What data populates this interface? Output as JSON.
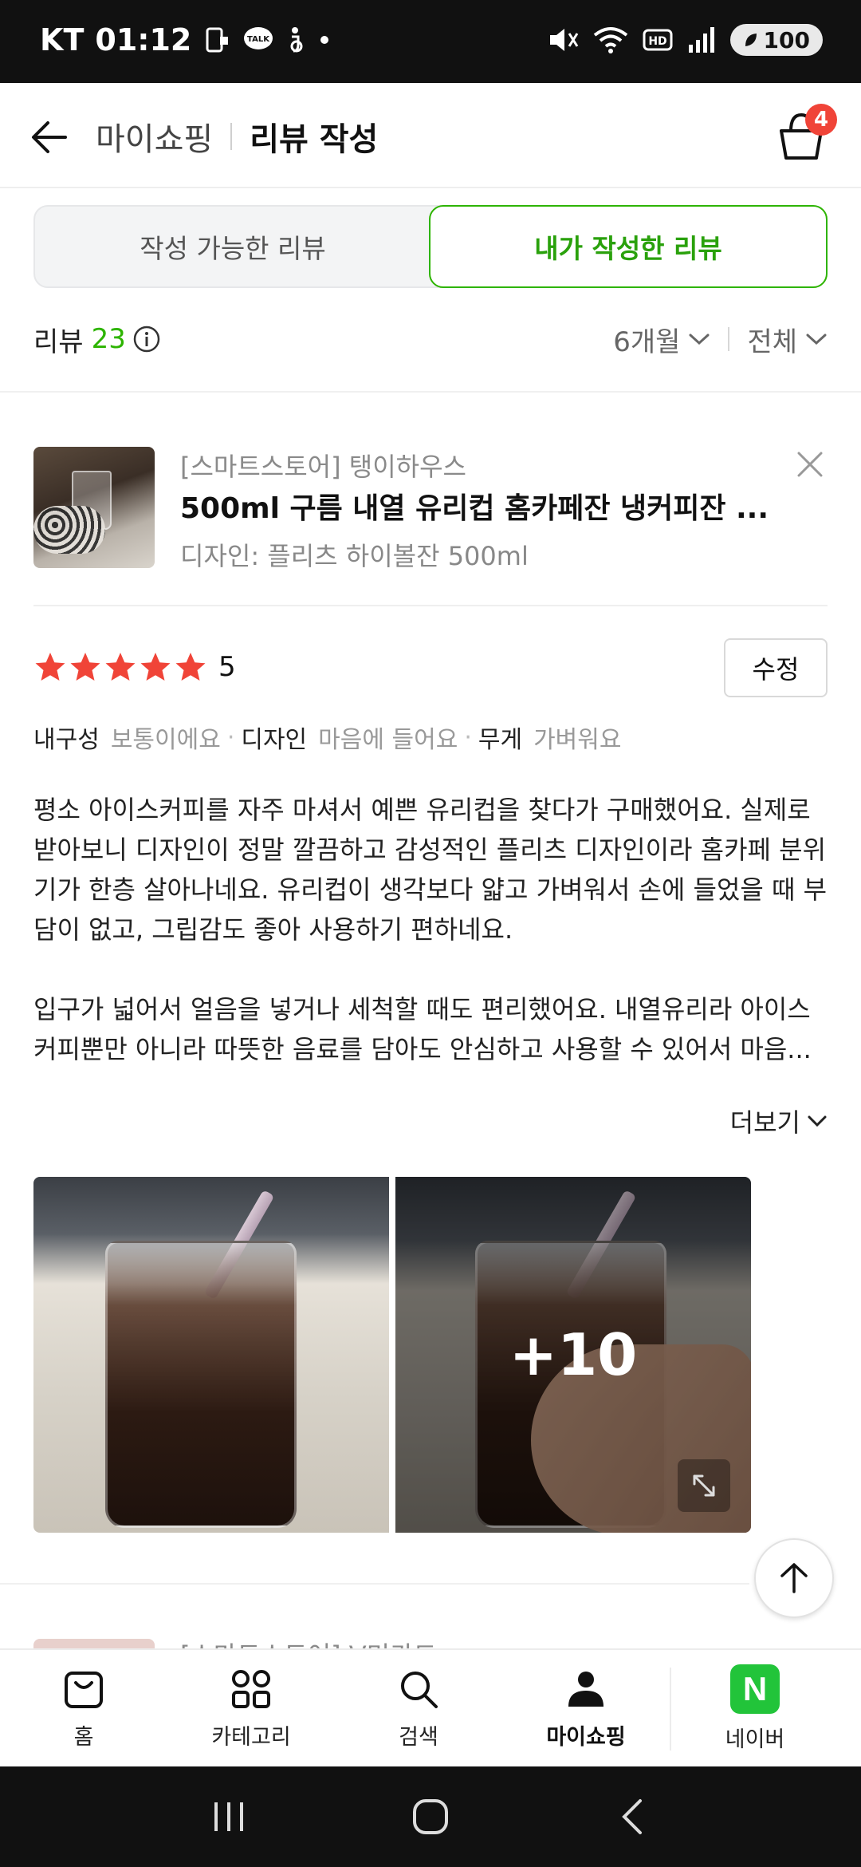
{
  "status_bar": {
    "carrier": "KT",
    "time": "01:12",
    "talk_badge": "TALK",
    "battery": "100"
  },
  "header": {
    "parent": "마이쇼핑",
    "title": "리뷰 작성",
    "cart_count": "4"
  },
  "tabs": [
    {
      "label": "작성 가능한 리뷰",
      "active": false
    },
    {
      "label": "내가 작성한 리뷰",
      "active": true
    }
  ],
  "summary": {
    "label": "리뷰",
    "count": "23",
    "period_filter": "6개월",
    "type_filter": "전체"
  },
  "review": {
    "store": "[스마트스토어] 탱이하우스",
    "product_name": "500ml 구름 내열 유리컵 홈카페잔 냉커피잔 ...",
    "option": "디자인: 플리츠 하이볼잔 500ml",
    "rating": 5,
    "rating_text": "5",
    "edit_label": "수정",
    "attributes": [
      {
        "key": "내구성",
        "value": "보통이에요"
      },
      {
        "key": "디자인",
        "value": "마음에 들어요"
      },
      {
        "key": "무게",
        "value": "가벼워요"
      }
    ],
    "text": [
      "평소 아이스커피를 자주 마셔서 예쁜 유리컵을 찾다가 구매했어요. 실제로 받아보니 디자인이 정말 깔끔하고 감성적인 플리츠 디자인이라 홈카페 분위기가 한층 살아나네요. 유리컵이 생각보다 얇고 가벼워서 손에 들었을 때 부담이 없고, 그립감도 좋아 사용하기 편하네요.",
      "입구가 넓어서 얼음을 넣거나 세척할 때도 편리했어요. 내열유리라 아이스커피뿐만 아니라 따뜻한 음료를 담아도 안심하고 사용할 수 있어서 마음..."
    ],
    "more_label": "더보기",
    "photo_more": "+10"
  },
  "next_review": {
    "store": "[스마트스토어] V미카드"
  },
  "bottom_nav": [
    {
      "label": "홈",
      "icon": "bag-icon"
    },
    {
      "label": "카테고리",
      "icon": "category-icon"
    },
    {
      "label": "검색",
      "icon": "search-icon"
    },
    {
      "label": "마이쇼핑",
      "icon": "person-icon",
      "active": true
    },
    {
      "label": "네이버",
      "icon": "naver-icon",
      "logo": "N"
    }
  ],
  "colors": {
    "accent": "#2db400",
    "star": "#f04438",
    "badge": "#f04438"
  }
}
